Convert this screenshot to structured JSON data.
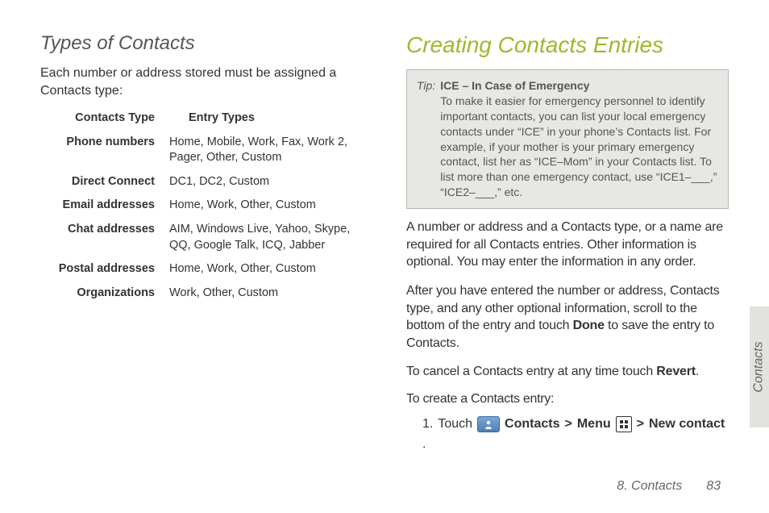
{
  "left": {
    "heading": "Types of Contacts",
    "intro": "Each number or address stored must be assigned a Contacts type:",
    "table": {
      "head_key": "Contacts Type",
      "head_val": "Entry Types",
      "rows": [
        {
          "key": "Phone numbers",
          "val": "Home, Mobile, Work, Fax, Work 2, Pager, Other, Custom"
        },
        {
          "key": "Direct Connect",
          "val": "DC1, DC2, Custom"
        },
        {
          "key": "Email addresses",
          "val": "Home, Work, Other, Custom"
        },
        {
          "key": "Chat addresses",
          "val": "AIM, Windows Live, Yahoo, Skype, QQ, Google Talk, ICQ, Jabber"
        },
        {
          "key": "Postal addresses",
          "val": "Home, Work, Other, Custom"
        },
        {
          "key": "Organizations",
          "val": "Work, Other, Custom"
        }
      ]
    }
  },
  "right": {
    "heading": "Creating Contacts Entries",
    "tip": {
      "label": "Tip:",
      "title": "ICE – In Case of Emergency",
      "body": "To make it easier for emergency personnel to identify important contacts, you can list your local emergency contacts under “ICE” in your phone’s Contacts list. For example, if your mother is your primary emergency contact, list her as “ICE–Mom” in your Contacts list. To list more than one emergency contact, use “ICE1–___,” “ICE2–___,” etc."
    },
    "p1": "A number or address and a Contacts type, or a name are required for all Contacts entries. Other information is optional. You may enter the information in any order.",
    "p2_a": "After you have entered the number or address, Contacts type, and any other optional information, scroll to the bottom of the entry and touch ",
    "p2_bold": "Done",
    "p2_b": " to save the entry to Contacts.",
    "p3_a": "To cancel a Contacts entry at any time touch ",
    "p3_bold": "Revert",
    "p3_b": ".",
    "create_intro": "To create a Contacts entry:",
    "step": {
      "num": "1.",
      "touch": "Touch",
      "contacts": "Contacts",
      "menu": "Menu",
      "newcontact": "New contact",
      "chev": ">",
      "period": "."
    }
  },
  "sidetab": "Contacts",
  "footer": {
    "section": "8. Contacts",
    "page": "83"
  }
}
